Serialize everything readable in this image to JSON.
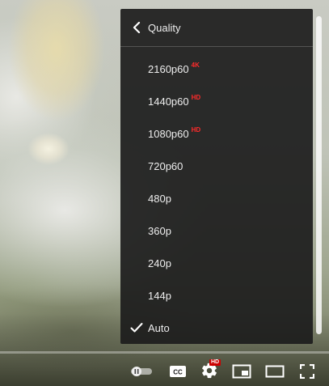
{
  "menu": {
    "title": "Quality",
    "items": [
      {
        "label": "2160p60",
        "badge": "4K",
        "selected": false
      },
      {
        "label": "1440p60",
        "badge": "HD",
        "selected": false
      },
      {
        "label": "1080p60",
        "badge": "HD",
        "selected": false
      },
      {
        "label": "720p60",
        "badge": "",
        "selected": false
      },
      {
        "label": "480p",
        "badge": "",
        "selected": false
      },
      {
        "label": "360p",
        "badge": "",
        "selected": false
      },
      {
        "label": "240p",
        "badge": "",
        "selected": false
      },
      {
        "label": "144p",
        "badge": "",
        "selected": false
      },
      {
        "label": "Auto",
        "badge": "",
        "selected": true
      }
    ]
  },
  "controls": {
    "settings_badge": "HD",
    "icons": [
      "autoplay-toggle-icon",
      "cc-icon",
      "settings-gear-icon",
      "miniplayer-icon",
      "theater-mode-icon",
      "fullscreen-icon"
    ]
  },
  "colors": {
    "menu_bg": "#1c1c1c",
    "badge_red": "#ff2b2b",
    "hd_badge_bg": "#cc0000",
    "text": "#eeeeee"
  }
}
